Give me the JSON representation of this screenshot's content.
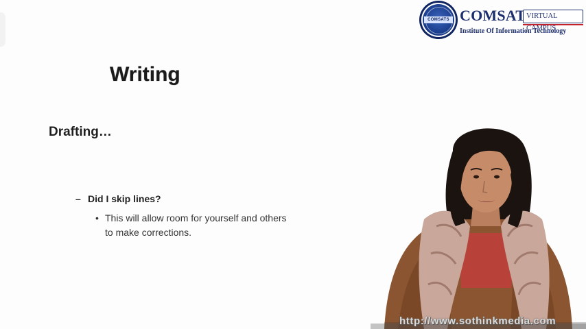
{
  "logo": {
    "title": "COMSATS",
    "badge": "VIRTUAL CAMPUS",
    "subtitle": "Institute Of Information Technology",
    "seal_text": "COMSATS",
    "brand_color": "#1e2f6e",
    "accent_color": "#c8202a"
  },
  "slide": {
    "title": "Writing",
    "subheading": "Drafting…",
    "dash_marker": "–",
    "question": "Did I skip lines?",
    "bullet_marker": "•",
    "bullet_line1": "This will allow room for yourself and others",
    "bullet_line2": "to make corrections."
  },
  "watermark": {
    "text": "http://www.sothinkmedia.com"
  }
}
